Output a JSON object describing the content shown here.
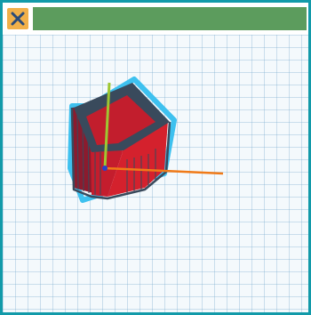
{
  "window": {
    "border_color": "#129aa9",
    "titlebar_color": "#5c9c5d",
    "close_button_color": "#f1b04a",
    "close_icon": "close-icon"
  },
  "viewport": {
    "grid_color": "#78aacd",
    "background": "#f4f9fc",
    "object": {
      "shape": "pentagonal-prism",
      "body_color": "#d11f2d",
      "edge_color": "#394a5c",
      "highlight_color": "#3ec1ef"
    },
    "axes": {
      "x_color": "#f07a18",
      "y_color": "#9ec732",
      "z_color": "#2741c9"
    }
  }
}
